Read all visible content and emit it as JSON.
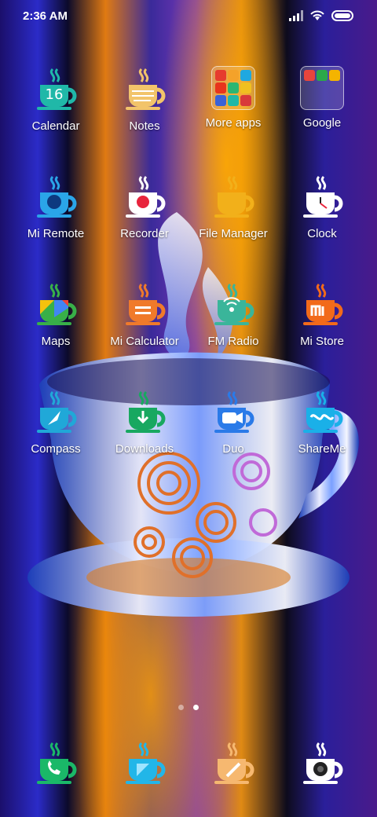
{
  "status": {
    "time": "2:36 AM"
  },
  "apps": [
    {
      "label": "Calendar",
      "icon": "calendar-icon",
      "color": "#20b8a8",
      "glyph": "16"
    },
    {
      "label": "Notes",
      "icon": "notes-icon",
      "color": "#f2c46a"
    },
    {
      "label": "More apps",
      "icon": "folder-icon",
      "color": "#ffffff"
    },
    {
      "label": "Google",
      "icon": "folder-icon",
      "color": "#ffffff"
    },
    {
      "label": "Mi Remote",
      "icon": "remote-icon",
      "color": "#2aa5e8"
    },
    {
      "label": "Recorder",
      "icon": "recorder-icon",
      "color": "#ffffff"
    },
    {
      "label": "File Manager",
      "icon": "file-manager-icon",
      "color": "#f2b01a"
    },
    {
      "label": "Clock",
      "icon": "clock-icon",
      "color": "#ffffff"
    },
    {
      "label": "Maps",
      "icon": "maps-icon",
      "color": "#38b048"
    },
    {
      "label": "Mi Calculator",
      "icon": "calculator-icon",
      "color": "#f07a2a"
    },
    {
      "label": "FM Radio",
      "icon": "radio-icon",
      "color": "#3ab59a"
    },
    {
      "label": "Mi Store",
      "icon": "store-icon",
      "color": "#f26a1a"
    },
    {
      "label": "Compass",
      "icon": "compass-icon",
      "color": "#20a8d8"
    },
    {
      "label": "Downloads",
      "icon": "download-icon",
      "color": "#18a860"
    },
    {
      "label": "Duo",
      "icon": "video-icon",
      "color": "#2a7ae8"
    },
    {
      "label": "ShareMe",
      "icon": "shareme-icon",
      "color": "#1ab0e8"
    }
  ],
  "dock": [
    {
      "icon": "phone-icon",
      "color": "#1ab868"
    },
    {
      "icon": "messages-icon",
      "color": "#22b6e8"
    },
    {
      "icon": "browser-icon",
      "color": "#f6b870"
    },
    {
      "icon": "camera-icon",
      "color": "#ffffff"
    }
  ]
}
